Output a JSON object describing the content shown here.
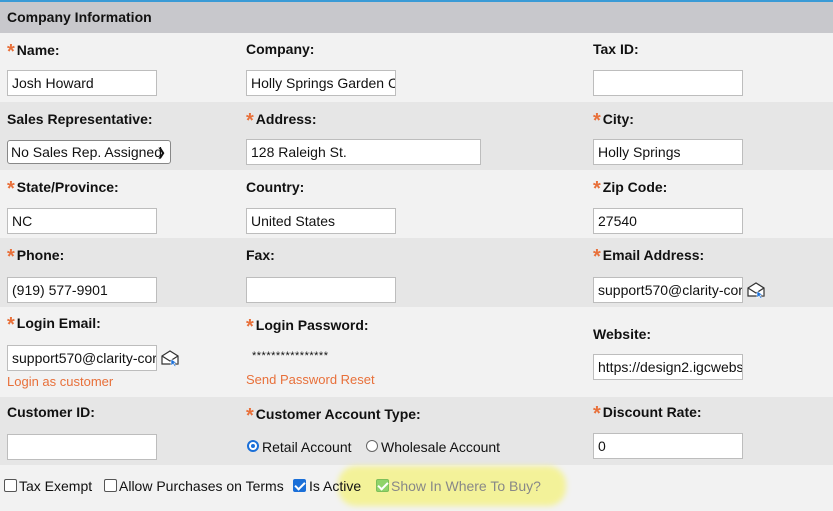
{
  "section_title": "Company Information",
  "fields": {
    "name": {
      "label": "Name:",
      "value": "Josh Howard"
    },
    "company": {
      "label": "Company:",
      "value": "Holly Springs Garden Ce"
    },
    "tax_id": {
      "label": "Tax ID:",
      "value": ""
    },
    "sales_rep": {
      "label": "Sales Representative:",
      "value": "No Sales Rep. Assigned"
    },
    "address": {
      "label": "Address:",
      "value": "128 Raleigh St."
    },
    "city": {
      "label": "City:",
      "value": "Holly Springs"
    },
    "state": {
      "label": "State/Province:",
      "value": "NC"
    },
    "country": {
      "label": "Country:",
      "value": "United States"
    },
    "zip": {
      "label": "Zip Code:",
      "value": "27540"
    },
    "phone": {
      "label": "Phone:",
      "value": "(919) 577-9901"
    },
    "fax": {
      "label": "Fax:",
      "value": ""
    },
    "email": {
      "label": "Email Address:",
      "value": "support570@clarity-cor"
    },
    "login_email": {
      "label": "Login Email:",
      "value": "support570@clarity-cor"
    },
    "login_password": {
      "label": "Login Password:",
      "value": "****************"
    },
    "website": {
      "label": "Website:",
      "value": "https://design2.igcwebs"
    },
    "customer_id": {
      "label": "Customer ID:",
      "value": ""
    },
    "account_type": {
      "label": "Customer Account Type:",
      "options": [
        "Retail Account",
        "Wholesale Account"
      ],
      "selected": "Retail Account"
    },
    "discount_rate": {
      "label": "Discount Rate:",
      "value": "0"
    }
  },
  "links": {
    "login_as_customer": "Login as customer",
    "send_password_reset": "Send Password Reset"
  },
  "checkboxes": {
    "tax_exempt": {
      "label": "Tax Exempt",
      "checked": false
    },
    "allow_terms": {
      "label": "Allow Purchases on Terms",
      "checked": false
    },
    "is_active": {
      "label": "Is Active",
      "checked": true
    },
    "show_where_to_buy": {
      "label": "Show In Where To Buy?",
      "checked": true,
      "disabled": true
    }
  },
  "required_marker": "*",
  "colors": {
    "accent": "#e8703a",
    "header_bg": "#c8c8cc",
    "checkbox_on": "#1a6fd8"
  },
  "icons": {
    "email": "envelope-cursor-icon"
  }
}
